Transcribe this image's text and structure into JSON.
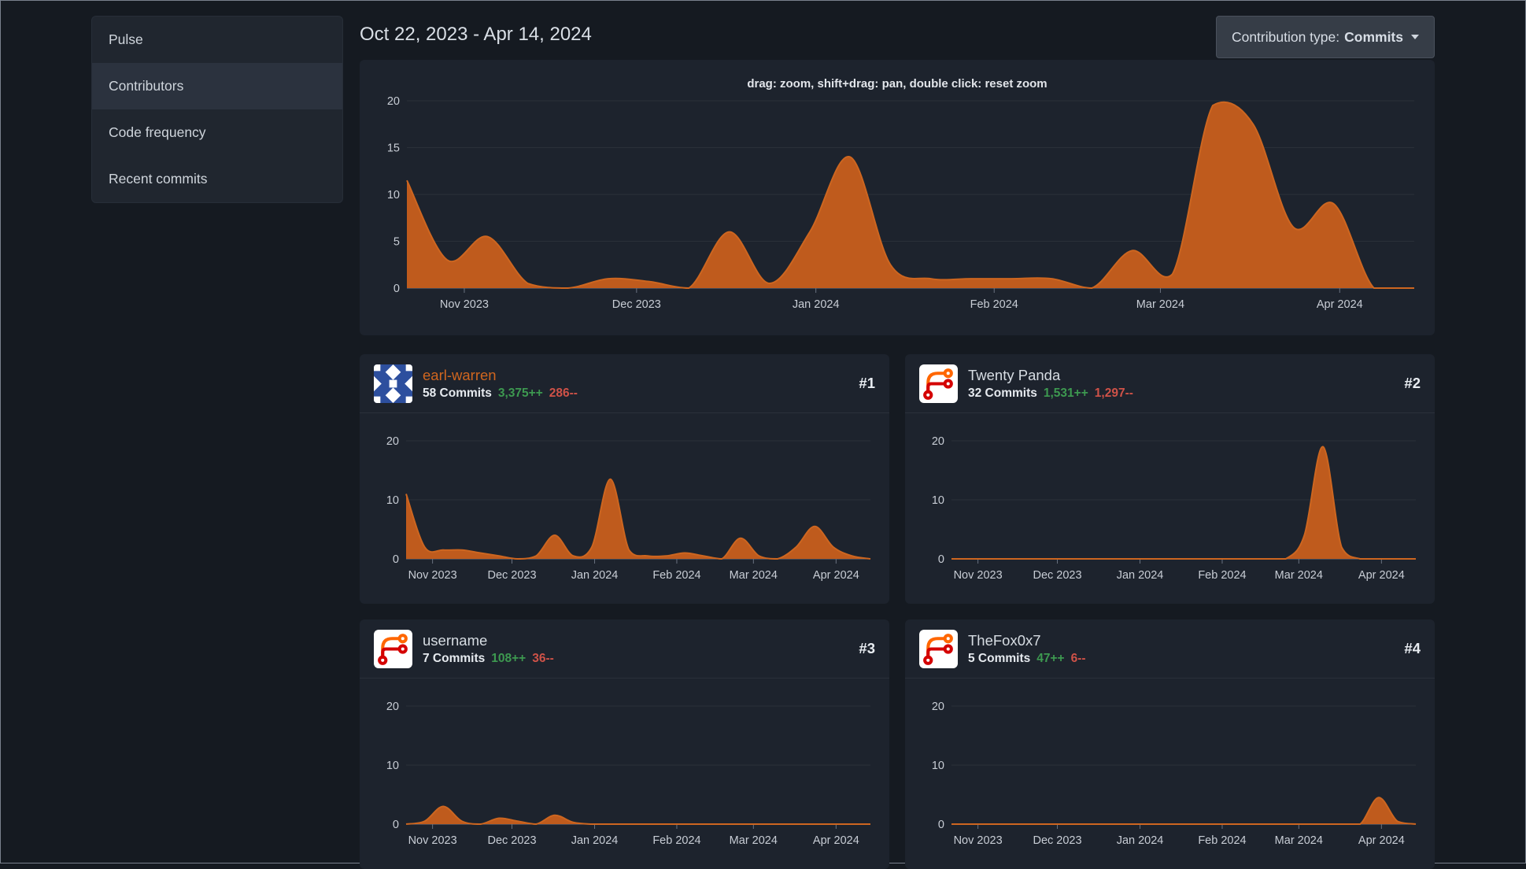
{
  "theme": {
    "chart_orange": "#bf5b1d",
    "chart_line_orange": "#cd6620",
    "link_orange": "#d0661f",
    "text_plain": "#d7dde3",
    "additions_green": "#3d9950",
    "deletions_red": "#cf5248"
  },
  "sidebar": {
    "items": [
      {
        "label": "Pulse",
        "active": false
      },
      {
        "label": "Contributors",
        "active": true
      },
      {
        "label": "Code frequency",
        "active": false
      },
      {
        "label": "Recent commits",
        "active": false
      }
    ]
  },
  "header": {
    "date_range": "Oct 22, 2023 - Apr 14, 2024",
    "contribution_type": {
      "label": "Contribution type:",
      "value": "Commits"
    }
  },
  "main_chart": {
    "hint": "drag: zoom, shift+drag: pan, double click: reset zoom"
  },
  "contributors": [
    {
      "rank": "#1",
      "name": "earl-warren",
      "name_color": "#d0661f",
      "commits": "58 Commits",
      "additions": "3,375++",
      "deletions": "286--",
      "avatar": "identicon-blue"
    },
    {
      "rank": "#2",
      "name": "Twenty Panda",
      "name_color": "#d7dde3",
      "commits": "32 Commits",
      "additions": "1,531++",
      "deletions": "1,297--",
      "avatar": "forgejo-logo"
    },
    {
      "rank": "#3",
      "name": "username",
      "name_color": "#d7dde3",
      "commits": "7 Commits",
      "additions": "108++",
      "deletions": "36--",
      "avatar": "forgejo-logo"
    },
    {
      "rank": "#4",
      "name": "TheFox0x7",
      "name_color": "#d7dde3",
      "commits": "5 Commits",
      "additions": "47++",
      "deletions": "6--",
      "avatar": "forgejo-logo"
    }
  ],
  "chart_data": [
    {
      "id": "all-contributors",
      "type": "area",
      "title": "",
      "ylim": [
        0,
        20
      ],
      "yticks": [
        0,
        5,
        10,
        15,
        20
      ],
      "color": "#bf5b1d",
      "line_color": "#cd6620",
      "x_months": [
        {
          "label": "Nov 2023",
          "pos": 0.057
        },
        {
          "label": "Dec 2023",
          "pos": 0.228
        },
        {
          "label": "Jan 2024",
          "pos": 0.406
        },
        {
          "label": "Feb 2024",
          "pos": 0.583
        },
        {
          "label": "Mar 2024",
          "pos": 0.748
        },
        {
          "label": "Apr 2024",
          "pos": 0.926
        }
      ],
      "values": [
        11.5,
        3,
        5.5,
        0.5,
        0,
        1,
        0.7,
        0,
        6,
        0.5,
        6,
        14,
        2.5,
        1,
        1,
        1,
        1,
        0,
        4,
        1.5,
        19.5,
        17.5,
        6.5,
        9,
        0,
        0
      ]
    },
    {
      "id": "earl-warren",
      "type": "area",
      "title": "",
      "ylim": [
        0,
        20
      ],
      "yticks": [
        0,
        10,
        20
      ],
      "color": "#bf5b1d",
      "line_color": "#cd6620",
      "x_months": [
        {
          "label": "Nov 2023",
          "pos": 0.057
        },
        {
          "label": "Dec 2023",
          "pos": 0.228
        },
        {
          "label": "Jan 2024",
          "pos": 0.406
        },
        {
          "label": "Feb 2024",
          "pos": 0.583
        },
        {
          "label": "Mar 2024",
          "pos": 0.748
        },
        {
          "label": "Apr 2024",
          "pos": 0.926
        }
      ],
      "values": [
        11,
        2,
        1.5,
        1.5,
        1,
        0.5,
        0,
        0.5,
        4,
        0.5,
        2,
        13.5,
        1.5,
        0.5,
        0.5,
        1,
        0.5,
        0,
        3.5,
        0.5,
        0,
        2,
        5.5,
        2,
        0.5,
        0
      ]
    },
    {
      "id": "twenty-panda",
      "type": "area",
      "title": "",
      "ylim": [
        0,
        20
      ],
      "yticks": [
        0,
        10,
        20
      ],
      "color": "#bf5b1d",
      "line_color": "#cd6620",
      "x_months": [
        {
          "label": "Nov 2023",
          "pos": 0.057
        },
        {
          "label": "Dec 2023",
          "pos": 0.228
        },
        {
          "label": "Jan 2024",
          "pos": 0.406
        },
        {
          "label": "Feb 2024",
          "pos": 0.583
        },
        {
          "label": "Mar 2024",
          "pos": 0.748
        },
        {
          "label": "Apr 2024",
          "pos": 0.926
        }
      ],
      "values": [
        0,
        0,
        0,
        0,
        0,
        0,
        0,
        0,
        0,
        0,
        0,
        0,
        0,
        0,
        0,
        0,
        0,
        0,
        0,
        4,
        19,
        2,
        0,
        0,
        0,
        0
      ]
    },
    {
      "id": "username",
      "type": "area",
      "title": "",
      "ylim": [
        0,
        20
      ],
      "yticks": [
        0,
        10,
        20
      ],
      "color": "#bf5b1d",
      "line_color": "#cd6620",
      "x_months": [
        {
          "label": "Nov 2023",
          "pos": 0.057
        },
        {
          "label": "Dec 2023",
          "pos": 0.228
        },
        {
          "label": "Jan 2024",
          "pos": 0.406
        },
        {
          "label": "Feb 2024",
          "pos": 0.583
        },
        {
          "label": "Mar 2024",
          "pos": 0.748
        },
        {
          "label": "Apr 2024",
          "pos": 0.926
        }
      ],
      "values": [
        0,
        0.5,
        3,
        0.5,
        0,
        1,
        0.5,
        0,
        1.5,
        0.3,
        0,
        0,
        0,
        0,
        0,
        0,
        0,
        0,
        0,
        0,
        0,
        0,
        0,
        0,
        0,
        0
      ]
    },
    {
      "id": "thefox0x7",
      "type": "area",
      "title": "",
      "ylim": [
        0,
        20
      ],
      "yticks": [
        0,
        10,
        20
      ],
      "color": "#bf5b1d",
      "line_color": "#cd6620",
      "x_months": [
        {
          "label": "Nov 2023",
          "pos": 0.057
        },
        {
          "label": "Dec 2023",
          "pos": 0.228
        },
        {
          "label": "Jan 2024",
          "pos": 0.406
        },
        {
          "label": "Feb 2024",
          "pos": 0.583
        },
        {
          "label": "Mar 2024",
          "pos": 0.748
        },
        {
          "label": "Apr 2024",
          "pos": 0.926
        }
      ],
      "values": [
        0,
        0,
        0,
        0,
        0,
        0,
        0,
        0,
        0,
        0,
        0,
        0,
        0,
        0,
        0,
        0,
        0,
        0,
        0,
        0,
        0,
        0,
        0,
        4.5,
        0.5,
        0
      ]
    }
  ]
}
